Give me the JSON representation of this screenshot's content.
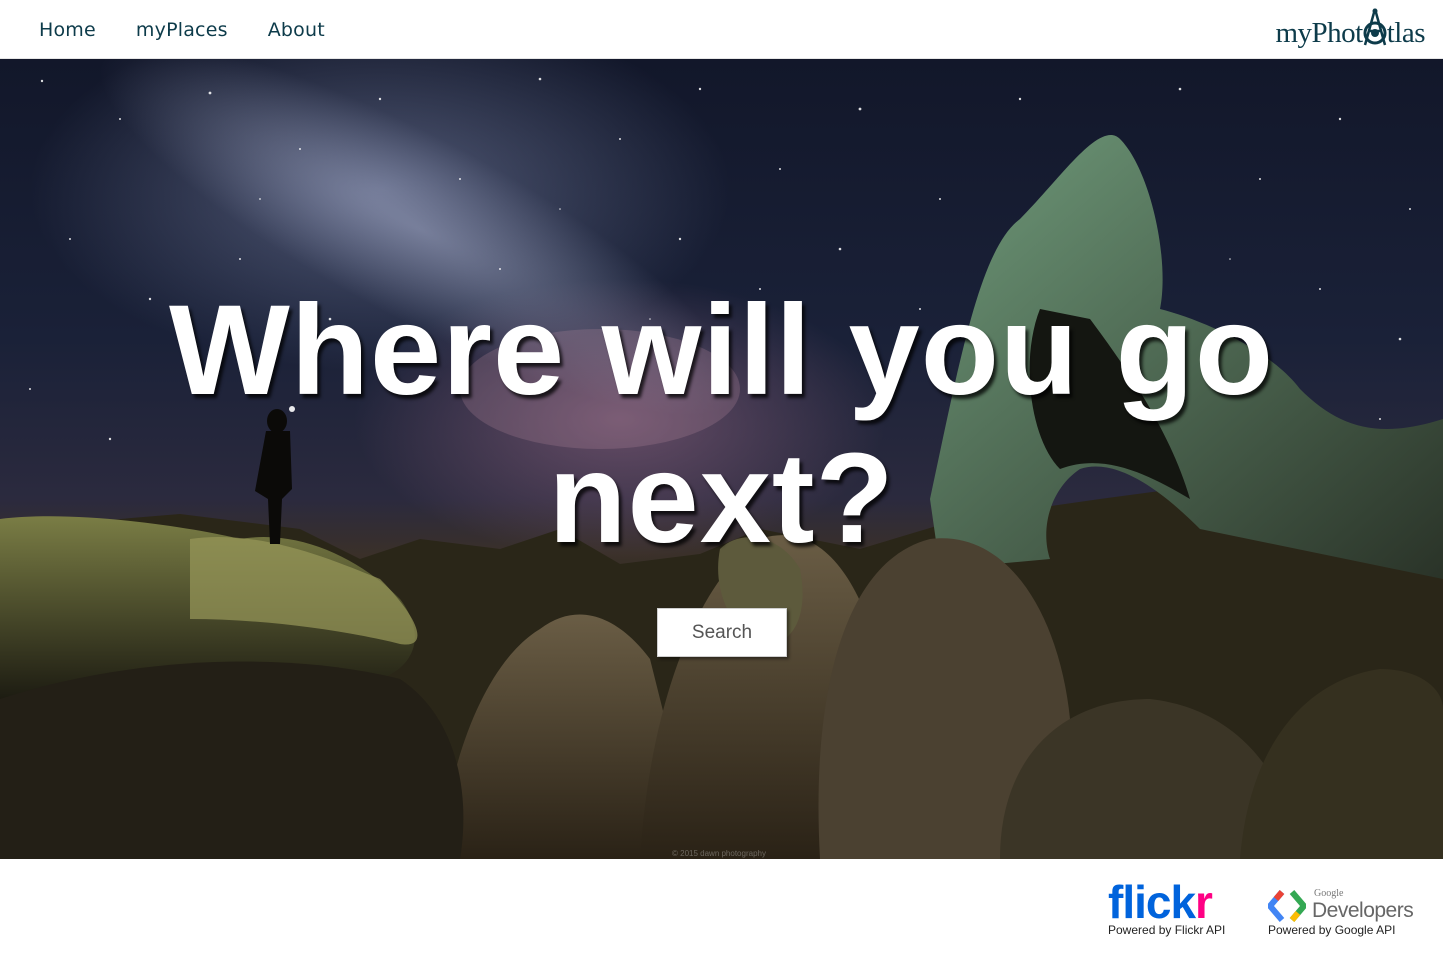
{
  "nav": {
    "links": [
      "Home",
      "myPlaces",
      "About"
    ],
    "brand": {
      "text_left": "myPhot",
      "text_right": "tlas",
      "icon": "camera-compass-icon"
    }
  },
  "hero": {
    "headline_line1": "Where will you go",
    "headline_line2": "next?",
    "search_label": "Search",
    "watermark": "© 2015 dawn photography"
  },
  "footer": {
    "flickr": {
      "logo_blue": "flick",
      "logo_pink": "r",
      "caption": "Powered by Flickr API"
    },
    "google": {
      "small": "Google",
      "product": "Developers",
      "caption": "Powered by Google API"
    }
  },
  "colors": {
    "nav_text": "#0d3b4a",
    "flickr_blue": "#0063dc",
    "flickr_pink": "#ff0084",
    "headline": "#ffffff"
  }
}
